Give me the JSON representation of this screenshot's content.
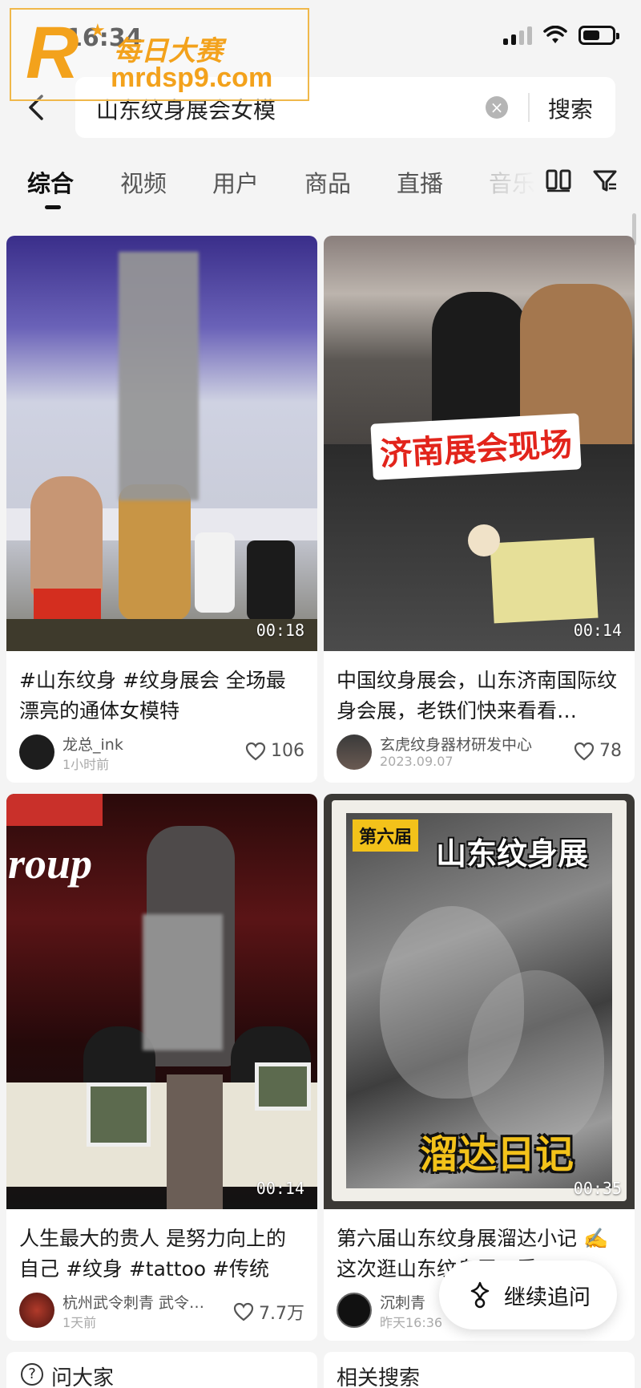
{
  "status_bar": {
    "time": "16:34"
  },
  "watermark": {
    "title": "每日大赛",
    "url": "mrdsp9.com"
  },
  "search": {
    "query": "山东纹身展会女模",
    "submit_label": "搜索"
  },
  "tabs": [
    "综合",
    "视频",
    "用户",
    "商品",
    "直播",
    "音乐"
  ],
  "results": [
    {
      "title": "#山东纹身 #纹身展会 全场最漂亮的通体女模特",
      "author": "龙总_ink",
      "posted": "1小时前",
      "likes": "106",
      "duration": "00:18"
    },
    {
      "title": "中国纹身展会，山东济南国际纹身会展，老铁们快来看看…",
      "author": "玄虎纹身器材研发中心",
      "posted": "2023.09.07",
      "likes": "78",
      "duration": "00:14",
      "overlay_text": "济南展会现场"
    },
    {
      "title": "人生最大的贵人 是努力向上的自己 #纹身 #tattoo #传统纹…",
      "author": "杭州武令刺青 武令…",
      "posted": "1天前",
      "likes": "7.7万",
      "duration": "00:14",
      "overlay_text": "roup"
    },
    {
      "title": "第六届山东纹身展溜达小记 ✍️ 这次逛山东纹身展，看…",
      "author": "沉刺青",
      "posted": "昨天16:36",
      "likes": "",
      "duration": "00:35",
      "overlay_badge": "第六届",
      "overlay_title": "山东纹身展",
      "overlay_bottom": "溜达日记"
    }
  ],
  "floating_action": {
    "label": "继续追问"
  },
  "bottom": {
    "ask_label": "问大家",
    "related_label": "相关搜索"
  },
  "colors": {
    "background": "#f4f4f4",
    "accent_red": "#e2241b",
    "watermark": "#f3a21c"
  }
}
